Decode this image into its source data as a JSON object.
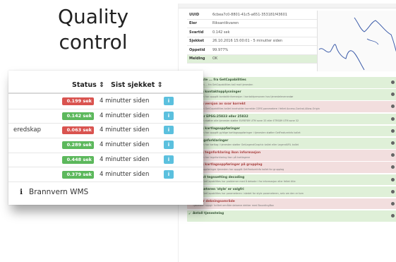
{
  "slide_title": {
    "line1": "Quality",
    "line2": "control"
  },
  "details": [
    {
      "key": "UUID",
      "value": "6cbea7c0-8801-41c5-a651-353181f43601"
    },
    {
      "key": "Eier",
      "value": "Riksantikvaren"
    },
    {
      "key": "Svartid",
      "value": "0.142 sek"
    },
    {
      "key": "Sjekket",
      "value": "26.10.2016 15:00:01 - 5 minutter siden"
    },
    {
      "key": "Oppetid",
      "value": "99.977%"
    },
    {
      "key": "Melding",
      "value": "OK"
    }
  ],
  "checks": [
    {
      "status": "ok",
      "title": "Tjeneste ... fra GetCapabilities",
      "desc": "Tjenesten ... fra GetCapabilities kall mot tjenesten"
    },
    {
      "status": "ok",
      "title": "Gyldig kontaktopplysninger",
      "desc": "Tjenesten har oppgitt kontaktinformasjon i kontaktpersonen hos tjenesteleverandør"
    },
    {
      "status": "fail",
      "title": "Gyldig versjon av svar korrekt",
      "desc": "Tjenesten GetCapabilities kallet inneholder korrekte CORS parametere i feltet Access-Control-Allow-Origin"
    },
    {
      "status": "ok",
      "title": "Støtter EPSG:25833 eller 25832",
      "desc": "Tjenesten støtter alle tjenester støtter EUREF89 UTM sone 33 eller ETRS89 UTM sone 32"
    },
    {
      "status": "ok",
      "title": "Gyldig kartlagsoppføringer",
      "desc": "Tjenesten har oppgitt gyldige kartlagsoppføringer i tjenesten støtter GetFeatureInfo kallet"
    },
    {
      "status": "ok",
      "title": "Kartlagsforklaringer",
      "desc": "Tjenesten har kartlag i tjenesten støtter GetLegendGraphic kallet eller LegendURL kallet"
    },
    {
      "status": "fail",
      "title": "Gyldig tegnforklaring ikon informasjon",
      "desc": "Tjenesten har tegnforklaring ikon på kartlagene"
    },
    {
      "status": "fail",
      "title": "Gyldig kartlagsoppføringer på grupplag",
      "desc": "Kartlagsoppføringer tjenesten har oppgitt GetFeatureInfo kallet for grupplag"
    },
    {
      "status": "ok",
      "title": "Korrekt tegnsetting decoding",
      "desc": "Svaret i GetCapabilities har problemer med å dekode i fra informasjon eller feltet title"
    },
    {
      "status": "ok",
      "title": "Parameteren 'style' er valgfri",
      "desc": "Svaret i GetCapabilities har parameteren i stedet for style parameteren, selv om den er tom"
    },
    {
      "status": "fail",
      "title": "Oppgir dekningsområde",
      "desc": "Tjenesten oppgir hvilket område dataene dekker med BoundingBox"
    },
    {
      "status": "ok",
      "title": "Antall tjenestelag",
      "desc": ""
    }
  ],
  "status_card": {
    "header_status": "Status ⇕",
    "header_checked": "Sist sjekket ⇕",
    "rows": [
      {
        "name": "",
        "time": "0.199 sek",
        "status": "fail",
        "checked": "4 minutter siden"
      },
      {
        "name": "",
        "time": "0.142 sek",
        "status": "ok",
        "checked": "4 minutter siden"
      },
      {
        "name": "eredskap",
        "time": "0.063 sek",
        "status": "fail",
        "checked": "4 minutter siden"
      },
      {
        "name": "",
        "time": "0.289 sek",
        "status": "ok",
        "checked": "4 minutter siden"
      },
      {
        "name": "",
        "time": "0.448 sek",
        "status": "ok",
        "checked": "4 minutter siden"
      },
      {
        "name": "",
        "time": "0.379 sek",
        "status": "ok",
        "checked": "4 minutter siden"
      }
    ],
    "info_button": "i",
    "footer_icon": "info-icon",
    "footer_label": "Brannvern WMS"
  },
  "colors": {
    "ok_badge": "#5cb85c",
    "fail_badge": "#d9534f",
    "info_button": "#5bc0de",
    "ok_row": "#dff0d8",
    "fail_row": "#f2dede"
  }
}
